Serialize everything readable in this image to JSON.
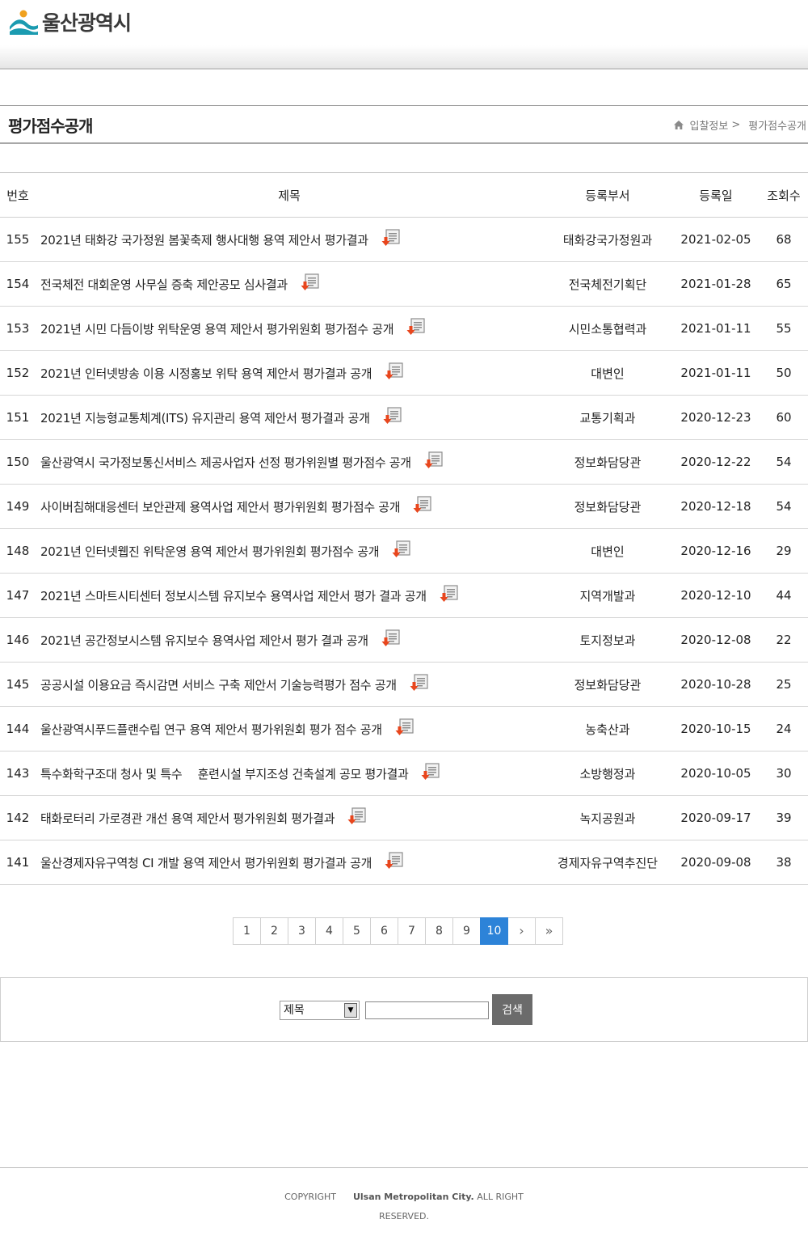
{
  "header": {
    "logo_text": "울산광역시"
  },
  "page": {
    "title": "평가점수공개",
    "breadcrumb": [
      "입찰정보",
      "평가점수공개"
    ],
    "breadcrumb_sep": ">"
  },
  "table": {
    "columns": [
      "번호",
      "제목",
      "등록부서",
      "등록일",
      "조회수"
    ],
    "rows": [
      {
        "no": "155",
        "title": "2021년 태화강 국가정원 봄꽃축제 행사대행 용역 제안서 평가결과",
        "dept": "태화강국가정원과",
        "date": "2021-02-05",
        "views": "68"
      },
      {
        "no": "154",
        "title": "전국체전 대회운영 사무실 증축 제안공모 심사결과",
        "dept": "전국체전기획단",
        "date": "2021-01-28",
        "views": "65"
      },
      {
        "no": "153",
        "title": "2021년 시민 다듬이방 위탁운영 용역 제안서 평가위원회 평가점수 공개",
        "dept": "시민소통협력과",
        "date": "2021-01-11",
        "views": "55"
      },
      {
        "no": "152",
        "title": "2021년 인터넷방송 이용 시정홍보 위탁 용역 제안서 평가결과 공개",
        "dept": "대변인",
        "date": "2021-01-11",
        "views": "50"
      },
      {
        "no": "151",
        "title": "2021년 지능형교통체계(ITS) 유지관리 용역 제안서 평가결과 공개",
        "dept": "교통기획과",
        "date": "2020-12-23",
        "views": "60"
      },
      {
        "no": "150",
        "title": "울산광역시 국가정보통신서비스 제공사업자 선정 평가위원별 평가점수 공개",
        "dept": "정보화담당관",
        "date": "2020-12-22",
        "views": "54"
      },
      {
        "no": "149",
        "title": "사이버침해대응센터 보안관제 용역사업 제안서 평가위원회 평가점수 공개",
        "dept": "정보화담당관",
        "date": "2020-12-18",
        "views": "54"
      },
      {
        "no": "148",
        "title": "2021년 인터넷웹진 위탁운영 용역 제안서 평가위원회 평가점수 공개",
        "dept": "대변인",
        "date": "2020-12-16",
        "views": "29"
      },
      {
        "no": "147",
        "title": "2021년 스마트시티센터 정보시스템 유지보수 용역사업 제안서 평가 결과 공개",
        "dept": "지역개발과",
        "date": "2020-12-10",
        "views": "44"
      },
      {
        "no": "146",
        "title": "2021년 공간정보시스템 유지보수 용역사업 제안서 평가 결과 공개",
        "dept": "토지정보과",
        "date": "2020-12-08",
        "views": "22"
      },
      {
        "no": "145",
        "title": "공공시설 이용요금 즉시감면 서비스 구축 제안서 기술능력평가 점수 공개",
        "dept": "정보화담당관",
        "date": "2020-10-28",
        "views": "25"
      },
      {
        "no": "144",
        "title": "울산광역시푸드플랜수립 연구 용역 제안서 평가위원회 평가 점수 공개",
        "dept": "농축산과",
        "date": "2020-10-15",
        "views": "24"
      },
      {
        "no": "143",
        "title": "특수화학구조대 청사 및 특수 　훈련시설 부지조성 건축설계 공모 평가결과",
        "dept": "소방행정과",
        "date": "2020-10-05",
        "views": "30"
      },
      {
        "no": "142",
        "title": "태화로터리 가로경관 개선 용역 제안서 평가위원회 평가결과",
        "dept": "녹지공원과",
        "date": "2020-09-17",
        "views": "39"
      },
      {
        "no": "141",
        "title": "울산경제자유구역청 CI 개발 용역 제안서 평가위원회 평가결과 공개",
        "dept": "경제자유구역추진단",
        "date": "2020-09-08",
        "views": "38"
      }
    ],
    "file_icon": "file-download-icon"
  },
  "pagination": {
    "pages": [
      "1",
      "2",
      "3",
      "4",
      "5",
      "6",
      "7",
      "8",
      "9",
      "10"
    ],
    "current": "10",
    "next": "›",
    "last": "»"
  },
  "search": {
    "select_value": "제목",
    "input_value": "",
    "button_label": "검색"
  },
  "footer": {
    "copyright_label": "COPYRIGHT",
    "org": "Ulsan Metropolitan City.",
    "rights_1": "ALL RIGHT",
    "rights_2": "RESERVED."
  },
  "colors": {
    "accent": "#2d83d8",
    "search_button": "#6b6b6b",
    "download_arrow": "#e8461d"
  }
}
